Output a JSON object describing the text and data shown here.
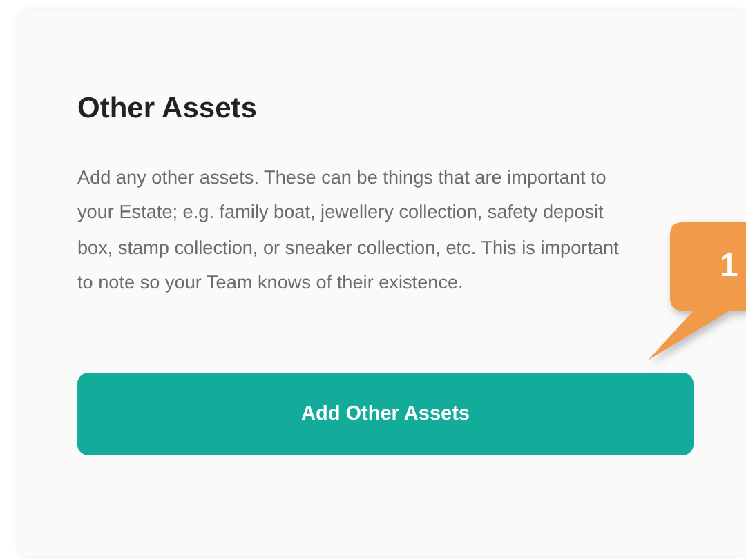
{
  "card": {
    "title": "Other Assets",
    "description": "Add any other assets. These can be things that are important to your Estate; e.g. family boat, jewellery collection, safety deposit box, stamp collection, or sneaker collection, etc. This is important to note so your Team knows of their existence.",
    "button": "Add Other Assets"
  },
  "callout": {
    "label": "1"
  }
}
